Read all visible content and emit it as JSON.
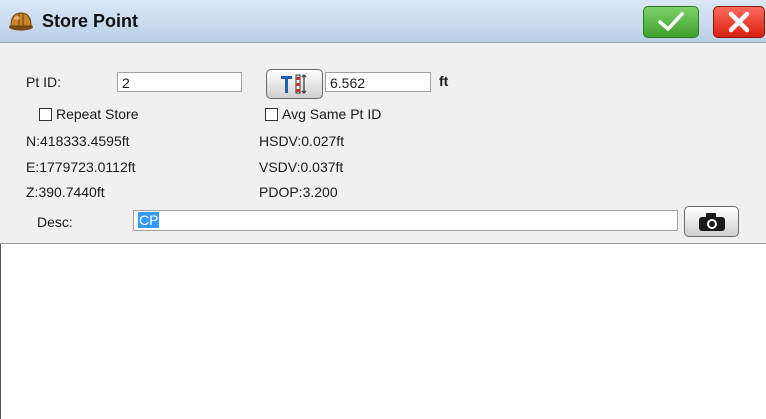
{
  "window": {
    "title": "Store Point"
  },
  "form": {
    "pt_id_label": "Pt ID:",
    "pt_id_value": "2",
    "height_value": "6.562",
    "height_unit": "ft",
    "repeat_store_label": "Repeat Store",
    "avg_same_label": "Avg Same Pt ID",
    "northing": "N:418333.4595ft",
    "easting": "E:1779723.0112ft",
    "elevation": "Z:390.7440ft",
    "hsdv": "HSDV:0.027ft",
    "vsdv": "VSDV:0.037ft",
    "pdop": "PDOP:3.200",
    "desc_label": "Desc:",
    "desc_value": "CP"
  },
  "colors": {
    "ok_green": "#3ea12c",
    "cancel_red": "#d91f10",
    "selection": "#3399ff"
  },
  "icons": {
    "title": "hard-hat-icon",
    "ok": "checkmark-icon",
    "cancel": "close-icon",
    "pole": "rod-height-icon",
    "camera": "camera-icon"
  }
}
